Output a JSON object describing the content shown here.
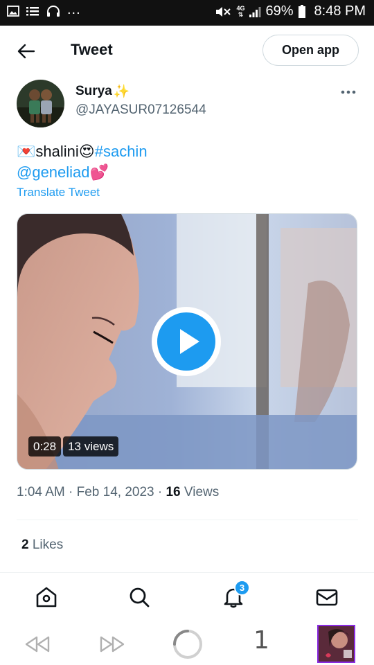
{
  "status_bar": {
    "battery": "69%",
    "time": "8:48 PM",
    "network": "4G",
    "more": "..."
  },
  "header": {
    "title": "Tweet",
    "open_app": "Open app",
    "back_icon": "arrow-left-icon"
  },
  "author": {
    "name": "Surya",
    "name_emoji": "✨",
    "handle": "@JAYASUR07126544"
  },
  "tweet": {
    "love_letter": "💌",
    "text_name": " shalini",
    "heart_eyes": "😍",
    "hashtag": "#sachin",
    "mention": "@geneliad",
    "hearts": " 💕",
    "translate": "Translate Tweet"
  },
  "media": {
    "duration": "0:28",
    "views": "13 views"
  },
  "meta": {
    "time": "1:04 AM",
    "sep": " · ",
    "date": "Feb 14, 2023",
    "view_count": "16",
    "views_label": " Views"
  },
  "engagement": {
    "likes_count": "2",
    "likes_label": " Likes"
  },
  "bottom_nav": {
    "notifications_badge": "3",
    "items": [
      "home-icon",
      "search-icon",
      "bell-icon",
      "mail-icon"
    ]
  },
  "browser_bar": {
    "tab_count": "1"
  },
  "colors": {
    "accent": "#1d9bf0",
    "text": "#0f1419",
    "secondary": "#536471",
    "border": "#cfd9de"
  }
}
